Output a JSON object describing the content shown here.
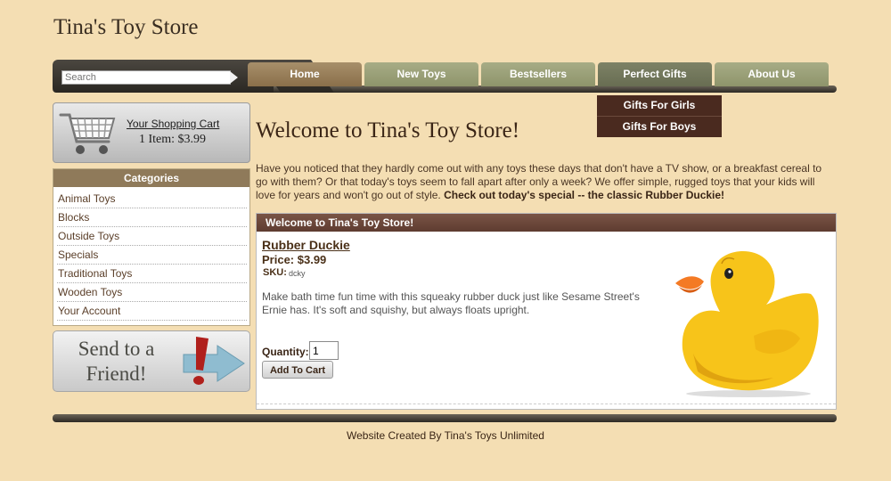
{
  "site": {
    "title": "Tina's Toy Store"
  },
  "search": {
    "placeholder": "Search"
  },
  "nav": {
    "tabs": [
      {
        "label": "Home"
      },
      {
        "label": "New Toys"
      },
      {
        "label": "Bestsellers"
      },
      {
        "label": "Perfect Gifts"
      },
      {
        "label": "About Us"
      }
    ],
    "dropdown": [
      {
        "label": "Gifts For Girls"
      },
      {
        "label": "Gifts For Boys"
      }
    ]
  },
  "cart": {
    "title": "Your Shopping Cart",
    "summary": "1 Item: $3.99"
  },
  "categories": {
    "heading": "Categories",
    "items": [
      "Animal Toys",
      "Blocks",
      "Outside Toys",
      "Specials",
      "Traditional Toys",
      "Wooden Toys",
      "Your Account"
    ]
  },
  "send_friend": {
    "line1": "Send to a",
    "line2": "Friend!"
  },
  "main": {
    "heading": "Welcome to Tina's Toy Store!",
    "intro": "Have you noticed that they hardly come out with any toys these days that don't have a TV show, or a breakfast cereal to go with them? Or that today's toys seem to fall apart after only a week? We offer simple, rugged toys that your kids will love for years and won't go out of style.",
    "intro_bold": "Check out today's special -- the classic Rubber Duckie!"
  },
  "product": {
    "box_heading": "Welcome to Tina's Toy Store!",
    "name": "Rubber Duckie",
    "price": "Price: $3.99",
    "sku_label": "SKU:",
    "sku": "dcky",
    "description": "Make bath time fun time with this squeaky rubber duck just like Sesame Street's Ernie has. It's soft and squishy, but always floats upright.",
    "quantity_label": "Quantity:",
    "quantity_value": "1",
    "add_button": "Add To Cart"
  },
  "footer": {
    "text": "Website Created By Tina's Toys Unlimited"
  },
  "colors": {
    "page_bg": "#f4deb3",
    "nav_home": "#8a6f4a",
    "nav_tab": "#8e946b",
    "nav_active": "#686d52",
    "dropdown_bg": "#4a2a1f",
    "product_header": "#5e3c30"
  }
}
